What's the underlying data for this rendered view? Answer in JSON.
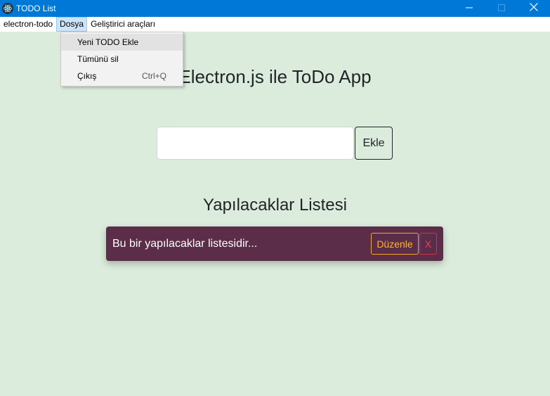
{
  "window": {
    "title": "TODO List",
    "controls": {
      "minimize_icon": "minimize-icon",
      "maximize_icon": "maximize-icon",
      "close_icon": "close-icon"
    }
  },
  "menubar": {
    "items": [
      {
        "label": "electron-todo"
      },
      {
        "label": "Dosya"
      },
      {
        "label": "Geliştirici araçları"
      }
    ]
  },
  "dropdown": {
    "items": [
      {
        "label": "Yeni TODO Ekle",
        "accelerator": ""
      },
      {
        "label": "Tümünü sil",
        "accelerator": ""
      },
      {
        "label": "Çıkış",
        "accelerator": "Ctrl+Q"
      }
    ]
  },
  "main": {
    "title": "Electron.js ile ToDo App",
    "input": {
      "value": "",
      "placeholder": ""
    },
    "add_button_label": "Ekle",
    "list_title": "Yapılacaklar Listesi",
    "todos": [
      {
        "text": "Bu bir yapılacaklar listesidir...",
        "edit_label": "Düzenle",
        "delete_label": "X"
      }
    ]
  },
  "colors": {
    "titlebar": "#0078d7",
    "background": "#dcecdc",
    "todo_background": "#5c2d48",
    "edit_accent": "#f7b733",
    "delete_accent": "#e0475c"
  }
}
